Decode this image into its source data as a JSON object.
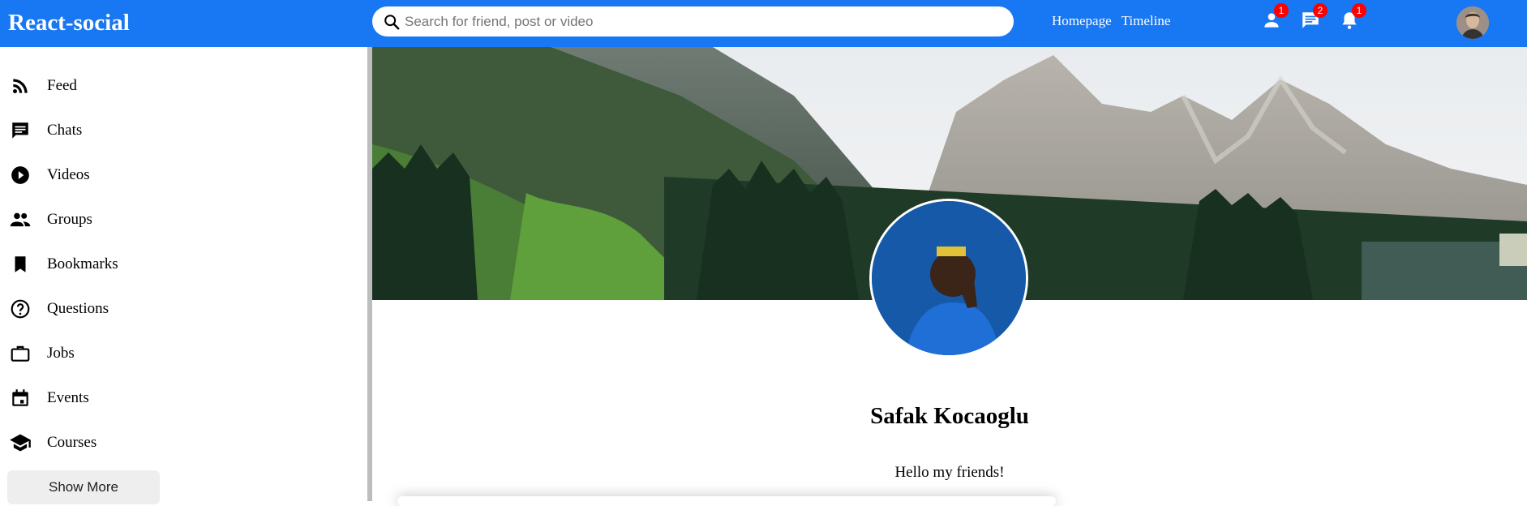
{
  "topbar": {
    "logo": "React-social",
    "search_placeholder": "Search for friend, post or video",
    "links": [
      "Homepage",
      "Timeline"
    ],
    "icons": [
      {
        "name": "person-icon",
        "badge": "1"
      },
      {
        "name": "chat-icon",
        "badge": "2"
      },
      {
        "name": "notifications-icon",
        "badge": "1"
      }
    ]
  },
  "sidebar": {
    "items": [
      {
        "label": "Feed",
        "icon": "rss-feed-icon"
      },
      {
        "label": "Chats",
        "icon": "chat-icon"
      },
      {
        "label": "Videos",
        "icon": "play-circle-icon"
      },
      {
        "label": "Groups",
        "icon": "group-icon"
      },
      {
        "label": "Bookmarks",
        "icon": "bookmark-icon"
      },
      {
        "label": "Questions",
        "icon": "help-outline-icon"
      },
      {
        "label": "Jobs",
        "icon": "work-outline-icon"
      },
      {
        "label": "Events",
        "icon": "event-icon"
      },
      {
        "label": "Courses",
        "icon": "school-icon"
      }
    ],
    "show_more": "Show More"
  },
  "profile": {
    "name": "Safak Kocaoglu",
    "description": "Hello my friends!"
  },
  "colors": {
    "topbar": "#1877f2",
    "badge": "#ff0000"
  }
}
